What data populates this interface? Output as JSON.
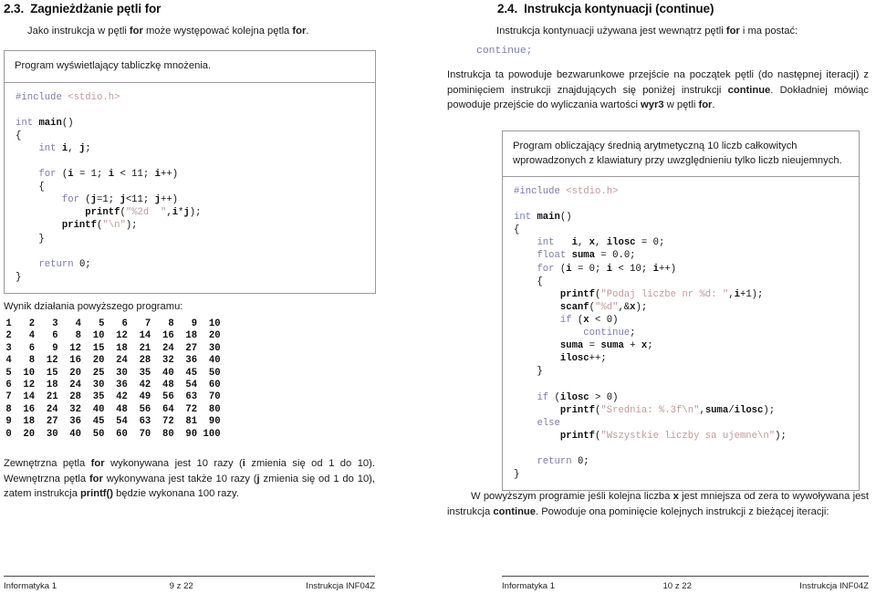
{
  "pages": [
    {
      "heading": {
        "number": "2.3.",
        "title": "Zagnieżdżanie pętli for"
      },
      "intro": "Jako instrukcja w pętli for może występować kolejna pętla for.",
      "example_box": {
        "caption": "Program wyświetlający tabliczkę mnożenia.",
        "code": "#include <stdio.h>\n\nint main()\n{\n    int i, j;\n\n    for (i = 1; i < 11; i++)\n    {\n        for (j=1; j<11; j++)\n            printf(\"%2d  \",i*j);\n        printf(\"\\n\");\n    }\n\n    return 0;\n}"
      },
      "output_label": "Wynik działania powyższego programu:",
      "output_rows": [
        " 1   2   3   4   5   6   7   8   9  10",
        " 2   4   6   8  10  12  14  16  18  20",
        " 3   6   9  12  15  18  21  24  27  30",
        " 4   8  12  16  20  24  28  32  36  40",
        " 5  10  15  20  25  30  35  40  45  50",
        " 6  12  18  24  30  36  42  48  54  60",
        " 7  14  21  28  35  42  49  56  63  70",
        " 8  16  24  32  40  48  56  64  72  80",
        " 9  18  27  36  45  54  63  72  81  90",
        " 0  20  30  40  50  60  70  80  90 100"
      ],
      "closing": "Zewnętrzna pętla for wykonywana jest 10 razy (i zmienia się od 1 do 10). Wewnętrzna pętla for wykonywana jest także 10 razy (j zmienia się od 1 do 10), zatem instrukcja printf() będzie wykonana 100 razy.",
      "footer": {
        "left": "Informatyka 1",
        "center": "9 z 22",
        "right": "Instrukcja INF04Z"
      }
    },
    {
      "heading": {
        "number": "2.4.",
        "title": "Instrukcja kontynuacji (continue)"
      },
      "intro": "Instrukcja kontynuacji używana jest wewnątrz pętli for i ma postać:",
      "syntax": "continue;",
      "para1": "Instrukcja ta powoduje bezwarunkowe przejście na początek pętli (do następnej iteracji) z pominięciem instrukcji znajdujących się poniżej instrukcji continue. Dokładniej mówiąc powoduje przejście do wyliczania wartości wyr3 w pętli for.",
      "example_box": {
        "caption": "Program obliczający średnią arytmetyczną 10 liczb całkowitych wprowadzonych z klawiatury przy uwzględnieniu tylko liczb nieujemnych.",
        "code": "#include <stdio.h>\n\nint main()\n{\n    int   i, x, ilosc = 0;\n    float suma = 0.0;\n    for (i = 0; i < 10; i++)\n    {\n        printf(\"Podaj liczbe nr %d: \",i+1);\n        scanf(\"%d\",&x);\n        if (x < 0)\n            continue;\n        suma = suma + x;\n        ilosc++;\n    }\n\n    if (ilosc > 0)\n        printf(\"Srednia: %.3f\\n\",suma/ilosc);\n    else\n        printf(\"Wszystkie liczby sa ujemne\\n\");\n\n    return 0;\n}"
      },
      "closing": "W powyższym programie jeśli kolejna liczba x jest mniejsza od zera to wywoływana jest instrukcja continue. Powoduje ona pominięcie kolejnych instrukcji z bieżącej iteracji:",
      "footer": {
        "left": "Informatyka 1",
        "center": "10 z 22",
        "right": "Instrukcja INF04Z"
      }
    }
  ],
  "colors": {
    "keyword": "#7b7bb5",
    "string": "#c39a9a",
    "box_border": "#9a9a9a",
    "text": "#1b1b1b"
  }
}
